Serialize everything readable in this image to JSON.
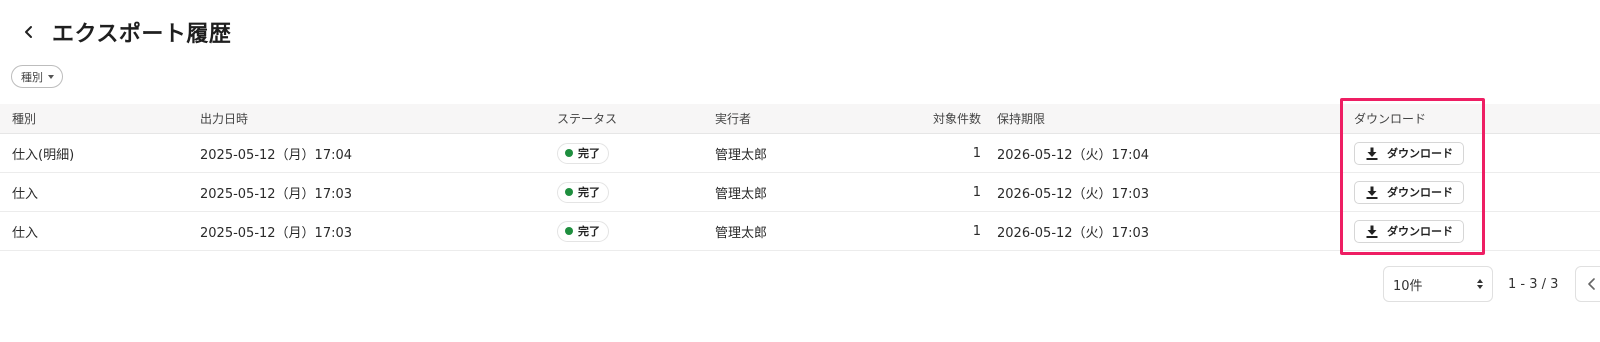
{
  "header": {
    "title": "エクスポート履歴",
    "back_icon": "chevron-left-icon"
  },
  "filter": {
    "label": "種別"
  },
  "table": {
    "columns": {
      "type": "種別",
      "date": "出力日時",
      "status": "ステータス",
      "user": "実行者",
      "count": "対象件数",
      "expire": "保持期限",
      "download": "ダウンロード"
    },
    "rows": [
      {
        "type": "仕入(明細)",
        "date": "2025-05-12（月）17:04",
        "status": "完了",
        "user": "管理太郎",
        "count": "1",
        "expire": "2026-05-12（火）17:04",
        "download": "ダウンロード"
      },
      {
        "type": "仕入",
        "date": "2025-05-12（月）17:03",
        "status": "完了",
        "user": "管理太郎",
        "count": "1",
        "expire": "2026-05-12（火）17:03",
        "download": "ダウンロード"
      },
      {
        "type": "仕入",
        "date": "2025-05-12（月）17:03",
        "status": "完了",
        "user": "管理太郎",
        "count": "1",
        "expire": "2026-05-12（火）17:03",
        "download": "ダウンロード"
      }
    ]
  },
  "pagination": {
    "per_page": "10件",
    "range": "1 - 3 / 3"
  },
  "colors": {
    "status_complete": "#1e8e3e",
    "highlight": "#ee1e63"
  }
}
